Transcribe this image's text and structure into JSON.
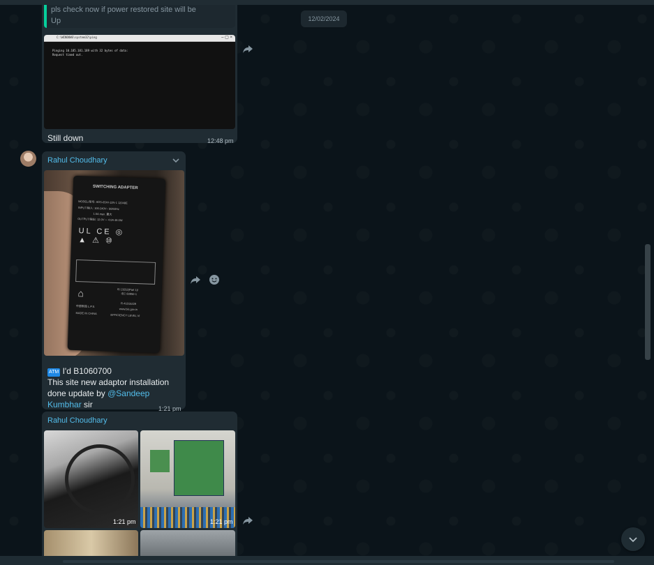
{
  "date_badge": "12/02/2024",
  "messages": [
    {
      "quote_text": "pls check now if power restored site will be Up",
      "text": "Still down",
      "time": "12:48 pm",
      "terminal": {
        "title": "C:\\WINDOWS\\system32\\ping",
        "lines": [
          "Pinging 10.185.181.189 with 32 bytes of data:",
          "Request timed out."
        ]
      }
    },
    {
      "sender": "Rahul Choudhary",
      "atm_badge": "ATM",
      "line1": " I'd B1060700",
      "line2": "This site new adaptor installation",
      "line3_prefix": "done update by ",
      "mention_part1": "@Sandeep",
      "mention_part2": "Kumbhar",
      "line4_suffix": " sir",
      "time": "1:21 pm",
      "adapter_label": {
        "brand": "SWITCHING ADAPTER",
        "model": "MODEL/型号: ADS-65HI-12N-1 12048E",
        "input": "INPUT/输入: 100-240V~ 50/60Hz",
        "current": "1.5A max. 最大",
        "output": "OUTPUT/输出: 12.0V ⎓ 4.0A 48.0W",
        "cert1": "IS 13252(Part 1)/",
        "cert2": "IEC 60950-1",
        "cert3": "R-41015229",
        "cert4": "www.bis.gov.in",
        "efficiency": "EFFICIENCY LEVEL VI",
        "made_in": "MADE IN CHINA",
        "lps": "中国制造   L.P.S."
      }
    },
    {
      "sender": "Rahul Choudhary",
      "photo1_time": "1:21 pm",
      "photo2_time": "1:21 pm"
    }
  ],
  "icons": {
    "forward": "forward-icon",
    "reaction": "emoji-icon",
    "chevron": "chevron-down-icon",
    "scroll_down": "arrow-down-icon"
  },
  "colors": {
    "background": "#0b141a",
    "bubble": "#202c33",
    "accent_name": "#53bdeb",
    "quote_bar": "#06cf9c"
  }
}
